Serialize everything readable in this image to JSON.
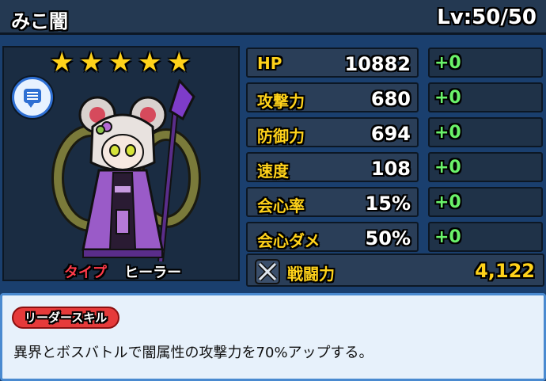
{
  "header": {
    "name": "みこ闇",
    "level": "Lv:50/50"
  },
  "character": {
    "stars": [
      "★",
      "★",
      "★",
      "★",
      "★"
    ],
    "chat_icon": "chat-bubble-icon",
    "type_label": "タイプ",
    "type_value": "ヒーラー"
  },
  "stats": [
    {
      "label": "HP",
      "value": "10882",
      "bonus": "+0"
    },
    {
      "label": "攻撃力",
      "value": "680",
      "bonus": "+0"
    },
    {
      "label": "防御力",
      "value": "694",
      "bonus": "+0"
    },
    {
      "label": "速度",
      "value": "108",
      "bonus": "+0"
    },
    {
      "label": "会心率",
      "value": "15%",
      "bonus": "+0"
    },
    {
      "label": "会心ダメ",
      "value": "50%",
      "bonus": "+0"
    }
  ],
  "power": {
    "icon": "crossed-swords-icon",
    "label": "戦闘力",
    "value": "4,122"
  },
  "leader_skill": {
    "tag": "リーダースキル",
    "description": "異界とボスバトルで闇属性の攻撃力を70%アップする。"
  },
  "colors": {
    "accent_yellow": "#ffd21a",
    "bonus_green": "#6af26a",
    "type_red": "#ff3b4a",
    "skill_red": "#e63a3a"
  }
}
